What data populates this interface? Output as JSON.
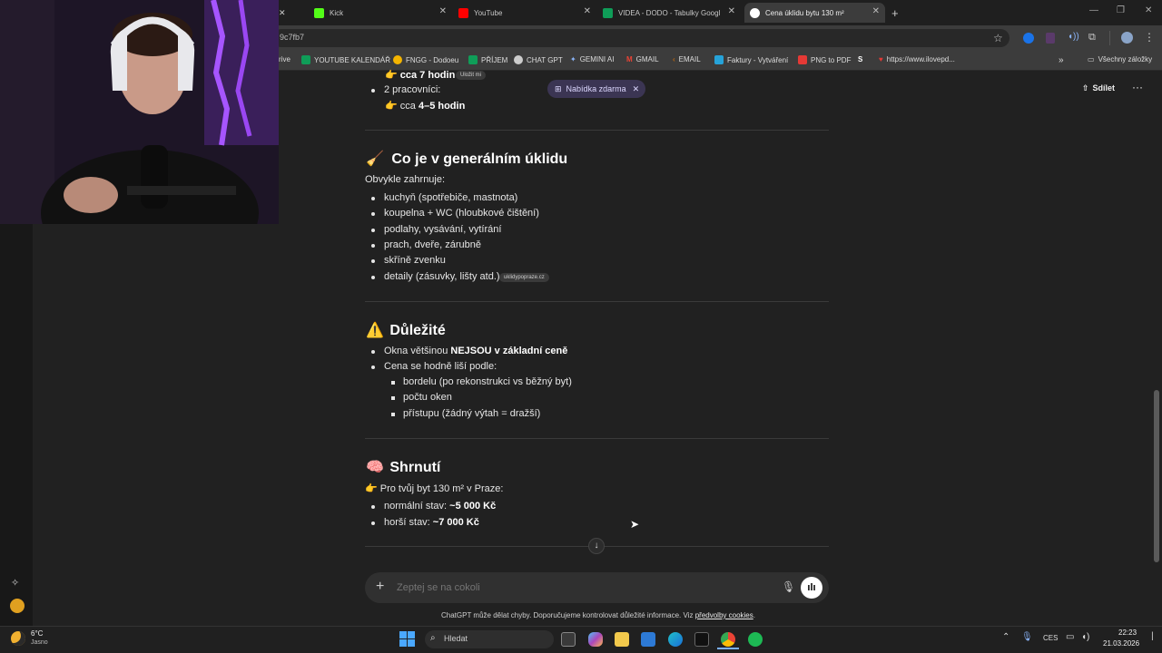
{
  "browser": {
    "tabs": [
      {
        "label": "Kick",
        "color": "#53fc18"
      },
      {
        "label": "YouTube",
        "color": "#ff0000"
      },
      {
        "label": "VIDEA - DODO - Tabulky Googl",
        "color": "#0f9d58"
      },
      {
        "label": "Cena úklidu bytu 130 m²",
        "color": "#ffffff"
      }
    ],
    "new_tab": "+",
    "url": "9c7fb7",
    "bookmarks": [
      {
        "label": "rive",
        "color": "#4285f4"
      },
      {
        "label": "YOUTUBE KALENDÁŘ",
        "color": "#0f9d58"
      },
      {
        "label": "FNGG - Dodoeu",
        "color": "#f4b400"
      },
      {
        "label": "PŘÍJEM",
        "color": "#0f9d58"
      },
      {
        "label": "CHAT GPT",
        "color": "#cccccc"
      },
      {
        "label": "GEMINI AI",
        "color": "#8ab4f8"
      },
      {
        "label": "GMAIL",
        "color": "#ea4335"
      },
      {
        "label": "EMAIL",
        "color": "#e37400"
      },
      {
        "label": "Faktury - Vytváření",
        "color": "#26a3d9"
      },
      {
        "label": "PNG to PDF",
        "color": "#e53935"
      },
      {
        "label": "https://www.ilovepd...",
        "color": "#e53935"
      }
    ],
    "all_bookmarks": "Všechny záložky"
  },
  "chat": {
    "offer_label": "Nabídka zdarma",
    "share_label": "Sdílet",
    "top_item_1": "cca 7 hodin",
    "top_chip": "Uložit mi",
    "top_item_2": "2 pracovníci:",
    "top_item_3_pre": "cca ",
    "top_item_3_bold": "4–5 hodin",
    "section1": {
      "emoji": "🧹",
      "title": "Co je v generálním úklidu",
      "intro": "Obvykle zahrnuje:",
      "items": [
        "kuchyň (spotřebiče, mastnota)",
        "koupelna + WC (hloubkové čištění)",
        "podlahy, vysávání, vytírání",
        "prach, dveře, zárubně",
        "skříně zvenku",
        "detaily (zásuvky, lišty atd.)"
      ],
      "source_chip": "uklidypopraze.cz"
    },
    "section2": {
      "emoji": "⚠️",
      "title": "Důležité",
      "item1_pre": "Okna většinou ",
      "item1_bold": "NEJSOU v základní ceně",
      "item2": "Cena se hodně liší podle:",
      "subitems": [
        "bordelu (po rekonstrukci vs běžný byt)",
        "počtu oken",
        "přístupu (žádný výtah = dražší)"
      ]
    },
    "section3": {
      "emoji": "🧠",
      "title": "Shrnutí",
      "intro": "👉 Pro tvůj byt 130 m² v Praze:",
      "item1_pre": "normální stav: ",
      "item1_bold": "~5 000 Kč",
      "item2_pre": "horší stav: ",
      "item2_bold": "~7 000 Kč"
    },
    "composer_placeholder": "Zeptej se na cokoli",
    "disclaimer_pre": "ChatGPT může dělat chyby. Doporučujeme kontrolovat důležité informace. Viz ",
    "disclaimer_link": "předvolby cookies",
    "disclaimer_post": "."
  },
  "taskbar": {
    "temp": "6°C",
    "condition": "Jasno",
    "search_label": "Hledat",
    "lang": "CES",
    "time": "22:23",
    "date": "21.03.2026"
  }
}
